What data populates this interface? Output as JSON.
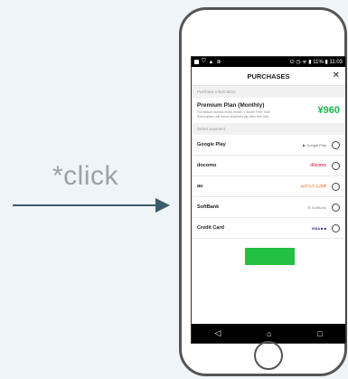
{
  "annotation": {
    "click_label": "*click"
  },
  "status_bar": {
    "right": "⏻ ◷ ᯤ ▮ 11% ▮ 11:03"
  },
  "header": {
    "title": "PURCHASES",
    "close_symbol": "✕"
  },
  "plan_section": {
    "label": "Purchase information",
    "plan_name": "Premium Plan (Monthly)",
    "plan_desc": "Full feature access every month. 1 Month Free Trial! Subscription will renew automatically after free trial.",
    "price": "¥960"
  },
  "payment_section": {
    "label": "Select payment",
    "methods": [
      {
        "name": "Google Play",
        "logo": "▶ Google Play",
        "logo_color": "#666666"
      },
      {
        "name": "docomo",
        "logo": "dōcomo",
        "logo_color": "#d3002c"
      },
      {
        "name": "au",
        "logo": "auかんたん決済",
        "logo_color": "#ea5504"
      },
      {
        "name": "SoftBank",
        "logo": "☰ SoftBank",
        "logo_color": "#888888"
      },
      {
        "name": "Credit Card",
        "logo": "VISA ■ ■",
        "logo_color": "#1a1f71"
      }
    ]
  },
  "nav": {
    "back": "◁",
    "home": "⌂",
    "recent": "□"
  },
  "colors": {
    "accent": "#22c043",
    "price": "#17b84b",
    "arrow": "#3b5b6b"
  }
}
